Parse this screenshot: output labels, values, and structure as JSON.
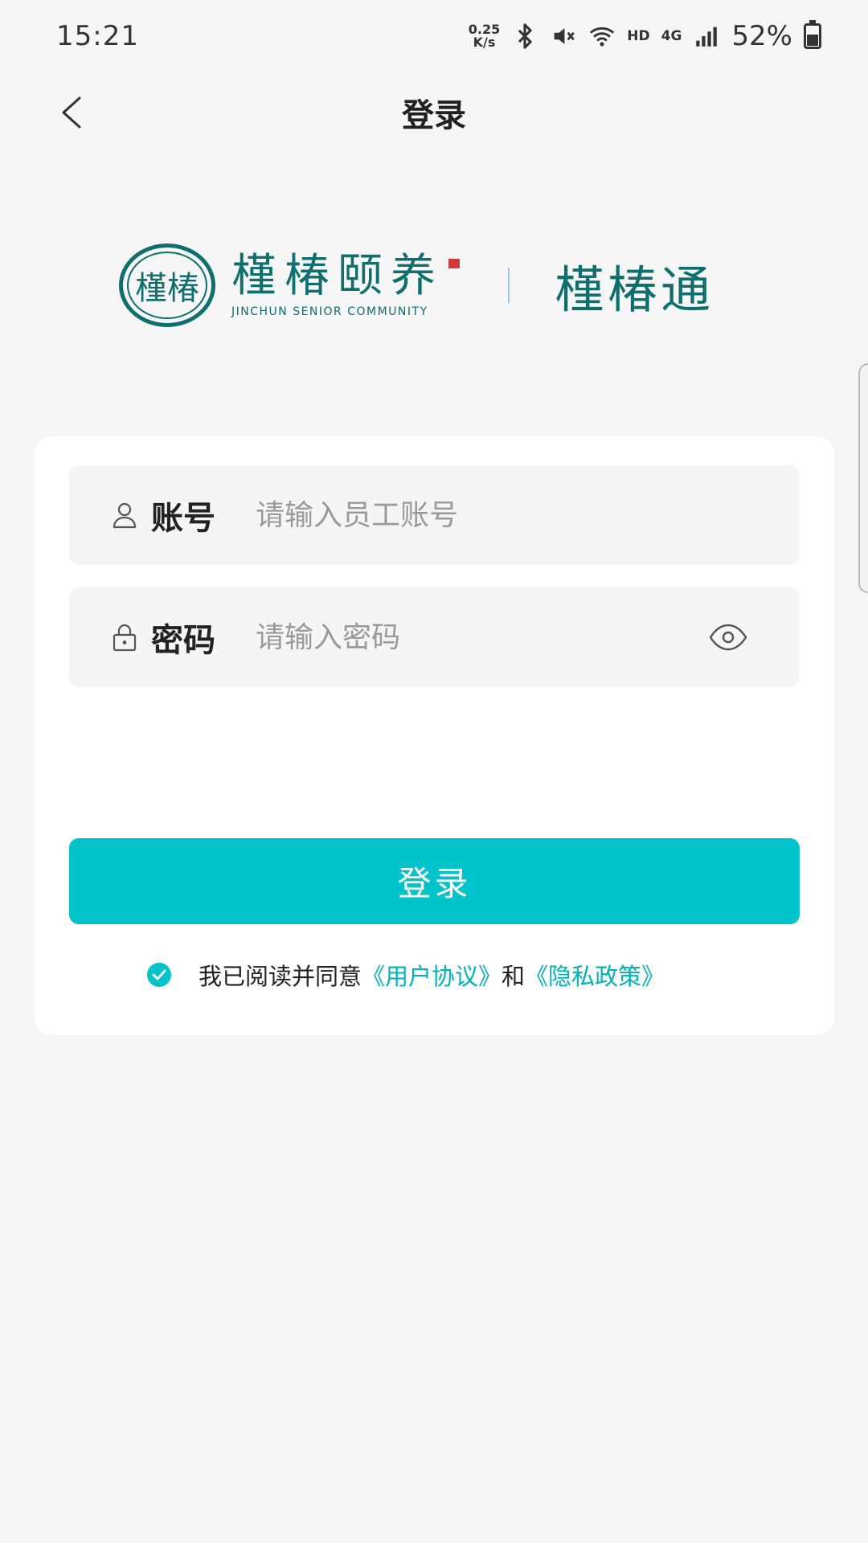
{
  "status_bar": {
    "time": "15:21",
    "net_speed_value": "0.25",
    "net_speed_unit": "K/s",
    "hd": "HD",
    "network": "4G",
    "battery": "52%"
  },
  "nav": {
    "title": "登录"
  },
  "brand": {
    "seal_text": "槿椿",
    "name": "槿椿颐养",
    "english": "JINCHUN SENIOR COMMUNITY",
    "app_name": "槿椿通"
  },
  "form": {
    "account_label": "账号",
    "account_placeholder": "请输入员工账号",
    "account_value": "",
    "password_label": "密码",
    "password_placeholder": "请输入密码",
    "password_value": "",
    "submit_label": "登录"
  },
  "agreement": {
    "checked": true,
    "prefix": "我已阅读并同意",
    "user_agreement": "《用户协议》",
    "conjunction": "和",
    "privacy_policy": "《隐私政策》"
  },
  "colors": {
    "accent": "#00c4ca",
    "brand": "#0f6e6e",
    "link": "#00b3ba",
    "background": "#f6f6f6"
  }
}
